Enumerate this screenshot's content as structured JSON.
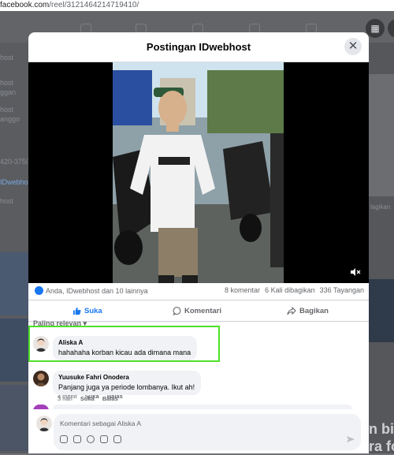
{
  "browser": {
    "url_domain": "facebook.com",
    "url_path": "/reel/3121464214719410/"
  },
  "background": {
    "left_labels": [
      "host",
      "host",
      "ggan",
      "host",
      "anggo",
      "420-3750",
      "IDwebhost",
      "host"
    ],
    "right_labels": [
      "lagikan",
      "n bi",
      "ra fo"
    ]
  },
  "modal": {
    "title": "Postingan IDwebhost",
    "close_icon": "close-icon"
  },
  "stats": {
    "reactions_text": "Anda, IDwebhost dan 10 lainnya",
    "comments": "8 komentar",
    "shares": "6 Kali dibagikan",
    "views": "336 Tayangan"
  },
  "actions": {
    "like": "Suka",
    "comment": "Komentari",
    "share": "Bagikan"
  },
  "sort_label": "Paling relevan",
  "comments": [
    {
      "name": "Aliska A",
      "text": "hahahaha korban kicau ada dimana mana",
      "time": "4 menit",
      "like": "Suka",
      "reply": "Balas"
    },
    {
      "name": "Yuusuke Fahri Onodera",
      "text": "Panjang juga ya periode lombanya. Ikut ah!",
      "time": "3 hari",
      "like": "Suka",
      "reply": "Balas"
    }
  ],
  "composer": {
    "placeholder": "Komentari sebagai Aliska A"
  },
  "colors": {
    "accent": "#1877f2",
    "highlight": "#4ee12a"
  }
}
